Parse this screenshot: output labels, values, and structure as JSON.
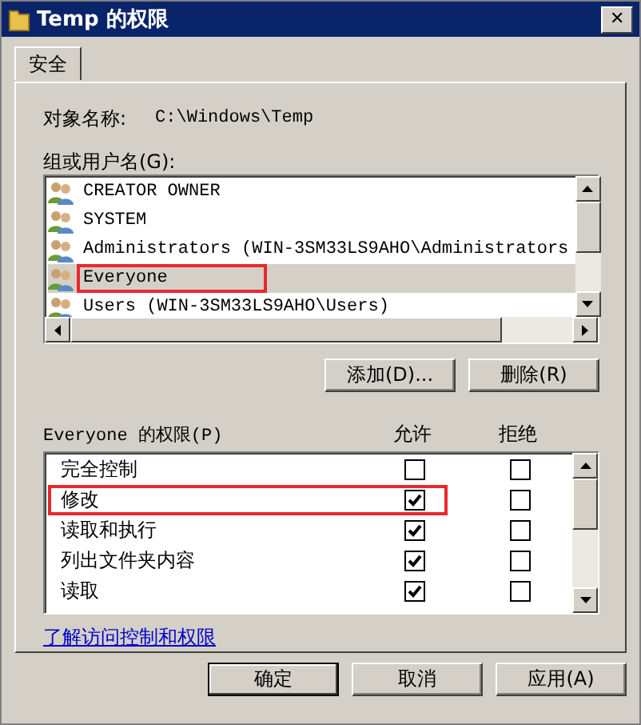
{
  "window": {
    "title": "Temp 的权限",
    "close": "✕"
  },
  "tabs": [
    {
      "label": "安全",
      "selected": true
    }
  ],
  "object_name": {
    "label": "对象名称:",
    "value": "C:\\Windows\\Temp"
  },
  "groups": {
    "label": "组或用户名(G):",
    "items": [
      {
        "name": "CREATOR OWNER",
        "selected": false,
        "highlighted": false
      },
      {
        "name": "SYSTEM",
        "selected": false,
        "highlighted": false
      },
      {
        "name": "Administrators (WIN-3SM33LS9AHO\\Administrators",
        "selected": false,
        "highlighted": false
      },
      {
        "name": "Everyone",
        "selected": true,
        "highlighted": true
      },
      {
        "name": "Users (WIN-3SM33LS9AHO\\Users)",
        "selected": false,
        "highlighted": false
      }
    ],
    "buttons": [
      "添加(D)...",
      "删除(R)"
    ]
  },
  "permissions": {
    "label": "Everyone 的权限(P)",
    "allow_header": "允许",
    "deny_header": "拒绝",
    "rows": [
      {
        "name": "完全控制",
        "allow": false,
        "deny": false,
        "highlighted": false
      },
      {
        "name": "修改",
        "allow": true,
        "deny": false,
        "highlighted": true
      },
      {
        "name": "读取和执行",
        "allow": true,
        "deny": false,
        "highlighted": false
      },
      {
        "name": "列出文件夹内容",
        "allow": true,
        "deny": false,
        "highlighted": false
      },
      {
        "name": "读取",
        "allow": true,
        "deny": false,
        "highlighted": false
      }
    ]
  },
  "link": "了解访问控制和权限",
  "buttons": [
    {
      "label": "确定",
      "default": true
    },
    {
      "label": "取消",
      "default": false
    },
    {
      "label": "应用(A)",
      "default": false
    }
  ]
}
